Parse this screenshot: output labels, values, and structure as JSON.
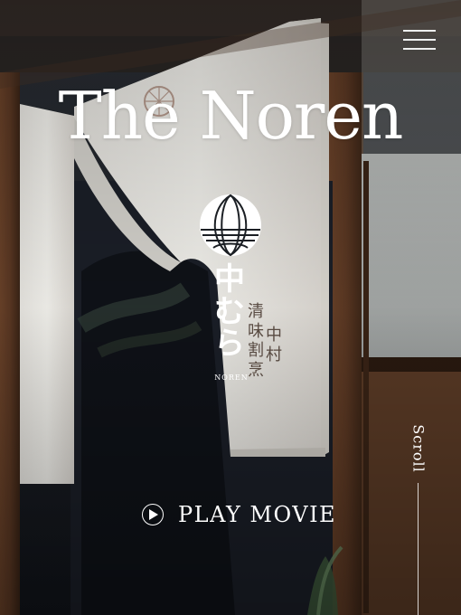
{
  "header": {
    "menu_icon": "hamburger-icon"
  },
  "hero": {
    "title": "The Noren",
    "brand": {
      "crest_icon": "family-crest-icon",
      "vertical_chars": [
        "中",
        "む",
        "ら"
      ],
      "latin": "NOREN"
    },
    "calligraphy_columns": [
      [
        "清",
        "味",
        "割",
        "烹"
      ],
      [
        "中",
        "村"
      ]
    ],
    "play": {
      "icon": "play-icon",
      "label": "PLAY MOVIE"
    },
    "scroll": {
      "label": "Scroll"
    }
  },
  "colors": {
    "text": "#ffffff",
    "curtain": "#f1f0eb",
    "wood": "#5a3a25",
    "shadow": "#151820"
  }
}
